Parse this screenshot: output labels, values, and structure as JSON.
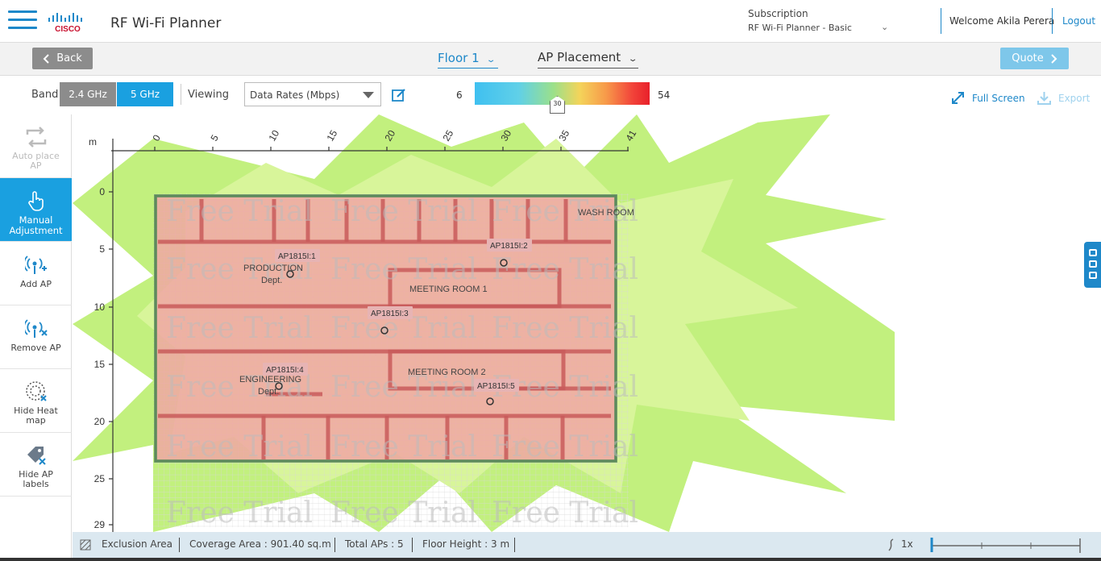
{
  "header": {
    "app_title": "RF Wi-Fi Planner",
    "subscription_label": "Subscription",
    "subscription_value": "RF Wi-Fi Planner - Basic",
    "welcome": "Welcome Akila Perera",
    "logout": "Logout",
    "logo_text": "CISCO"
  },
  "toolbar": {
    "back": "Back",
    "floor": "Floor 1",
    "mode": "AP Placement",
    "quote": "Quote"
  },
  "controls": {
    "band_label": "Band",
    "band_24": "2.4 GHz",
    "band_5": "5 GHz",
    "active_band": "5 GHz",
    "viewing_label": "Viewing",
    "viewing_value": "Data Rates (Mbps)",
    "scale_min": "6",
    "scale_max": "54",
    "slider_value": "30",
    "slider_fraction": 0.47,
    "full_screen": "Full Screen",
    "export": "Export"
  },
  "rail": {
    "tools": [
      {
        "label": "Auto place AP",
        "state": "disabled"
      },
      {
        "label": "Manual Adjustment",
        "state": "active"
      },
      {
        "label": "Add AP",
        "state": "normal"
      },
      {
        "label": "Remove AP",
        "state": "normal"
      },
      {
        "label": "Hide Heat map",
        "state": "normal"
      },
      {
        "label": "Hide AP labels",
        "state": "normal"
      }
    ]
  },
  "map": {
    "unit": "m",
    "x_ticks": [
      "0",
      "5",
      "10",
      "15",
      "20",
      "25",
      "30",
      "35",
      "41"
    ],
    "y_ticks": [
      "0",
      "5",
      "10",
      "15",
      "20",
      "25",
      "29"
    ],
    "watermark": "Free Trial",
    "rooms": [
      "WASH ROOM",
      "PRODUCTION",
      "Dept.",
      "MEETING ROOM 1",
      "ENGINEERING",
      "Dept.",
      "MEETING ROOM 2"
    ],
    "aps": [
      "AP1815I:1",
      "AP1815I:2",
      "AP1815I:3",
      "AP1815I:4",
      "AP1815I:5"
    ]
  },
  "status": {
    "exclusion": "Exclusion Area",
    "coverage": "Coverage Area : 901.40  sq.m",
    "total_aps": "Total APs : 5",
    "floor_height": "Floor Height : 3 m",
    "zoom": "1x"
  },
  "colors": {
    "accent": "#1e88c9",
    "active_tool": "#1aa0e0",
    "heat_green": "#b8f070",
    "heat_red": "#f59a9a"
  }
}
